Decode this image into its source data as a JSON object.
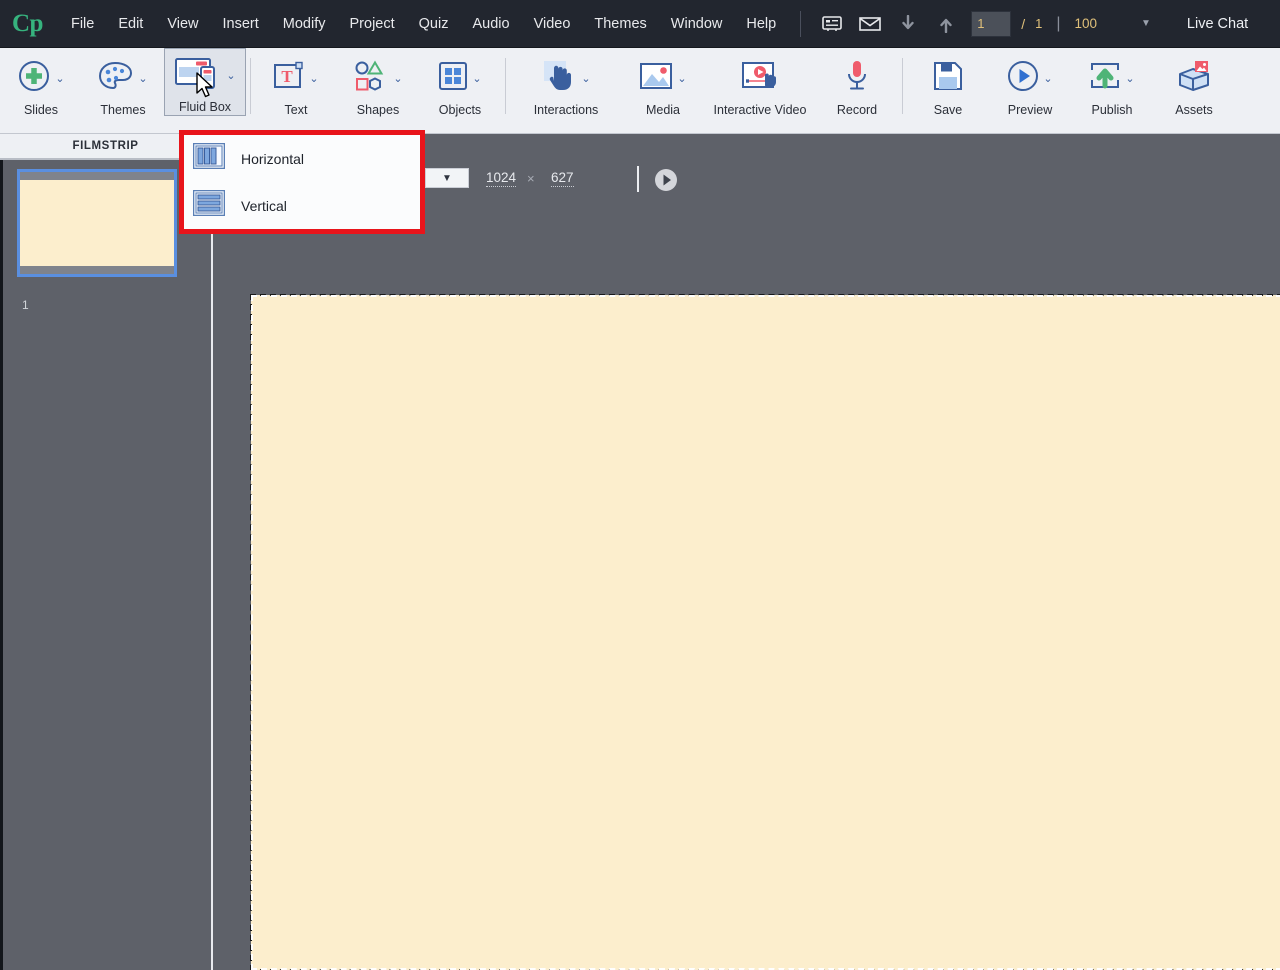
{
  "app": {
    "name": "Adobe Captivate",
    "logo_text": "Cp",
    "logo_color": "#36b37e"
  },
  "menubar": {
    "items": [
      {
        "label": "File"
      },
      {
        "label": "Edit"
      },
      {
        "label": "View"
      },
      {
        "label": "Insert"
      },
      {
        "label": "Modify"
      },
      {
        "label": "Project"
      },
      {
        "label": "Quiz"
      },
      {
        "label": "Audio"
      },
      {
        "label": "Video"
      },
      {
        "label": "Themes"
      },
      {
        "label": "Window"
      },
      {
        "label": "Help"
      }
    ],
    "icons": [
      {
        "name": "filmstrip-panel-icon"
      },
      {
        "name": "mail-icon"
      },
      {
        "name": "download-arrow-icon"
      },
      {
        "name": "upload-arrow-icon"
      }
    ],
    "page_current": "1",
    "page_separator": "/",
    "page_total": "1",
    "divider": "|",
    "zoom_value": "100",
    "zoom_caret": "▼",
    "live_chat": "Live Chat"
  },
  "ribbon": {
    "tools": [
      {
        "label": "Slides",
        "icon": "add-slide-icon",
        "caret": true,
        "active": false
      },
      {
        "label": "Themes",
        "icon": "palette-icon",
        "caret": true,
        "active": false
      },
      {
        "label": "Fluid Box",
        "icon": "fluid-box-icon",
        "caret": true,
        "active": true
      },
      {
        "label": "Text",
        "icon": "text-box-icon",
        "caret": true,
        "active": false
      },
      {
        "label": "Shapes",
        "icon": "shapes-icon",
        "caret": true,
        "active": false
      },
      {
        "label": "Objects",
        "icon": "objects-grid-icon",
        "caret": true,
        "active": false
      },
      {
        "label": "Interactions",
        "icon": "hand-pointer-icon",
        "caret": true,
        "active": false
      },
      {
        "label": "Media",
        "icon": "image-media-icon",
        "caret": true,
        "active": false
      },
      {
        "label": "Interactive Video",
        "icon": "interactive-video-icon",
        "caret": false,
        "active": false
      },
      {
        "label": "Record",
        "icon": "microphone-icon",
        "caret": false,
        "active": false
      },
      {
        "label": "Save",
        "icon": "floppy-disk-icon",
        "caret": false,
        "active": false
      },
      {
        "label": "Preview",
        "icon": "play-circle-icon",
        "caret": true,
        "active": false
      },
      {
        "label": "Publish",
        "icon": "publish-upload-icon",
        "caret": true,
        "active": false
      },
      {
        "label": "Assets",
        "icon": "assets-box-icon",
        "caret": false,
        "active": false
      }
    ]
  },
  "dropdown": {
    "name": "fluid-box-orientation-menu",
    "border_color": "#e8141b",
    "items": [
      {
        "label": "Horizontal",
        "icon": "horizontal-columns-icon"
      },
      {
        "label": "Vertical",
        "icon": "vertical-rows-icon"
      }
    ]
  },
  "filmstrip": {
    "header": "FILMSTRIP",
    "slides": [
      {
        "number": "1",
        "selected": true
      }
    ]
  },
  "canvas_toolbar": {
    "preset_caret": "▼",
    "width_value": "1024",
    "times_symbol": "×",
    "height_value": "627",
    "play_icon": "play-circle-icon"
  },
  "colors": {
    "chrome_dark": "#22262f",
    "ribbon_bg": "#eef0f4",
    "workspace_gray": "#5e6169",
    "slide_cream": "#fceecd",
    "accent_blue": "#3a5f9e",
    "accent_red": "#e8141b",
    "value_gold": "#e0c07a",
    "thumb_border": "#5a8fe0"
  }
}
